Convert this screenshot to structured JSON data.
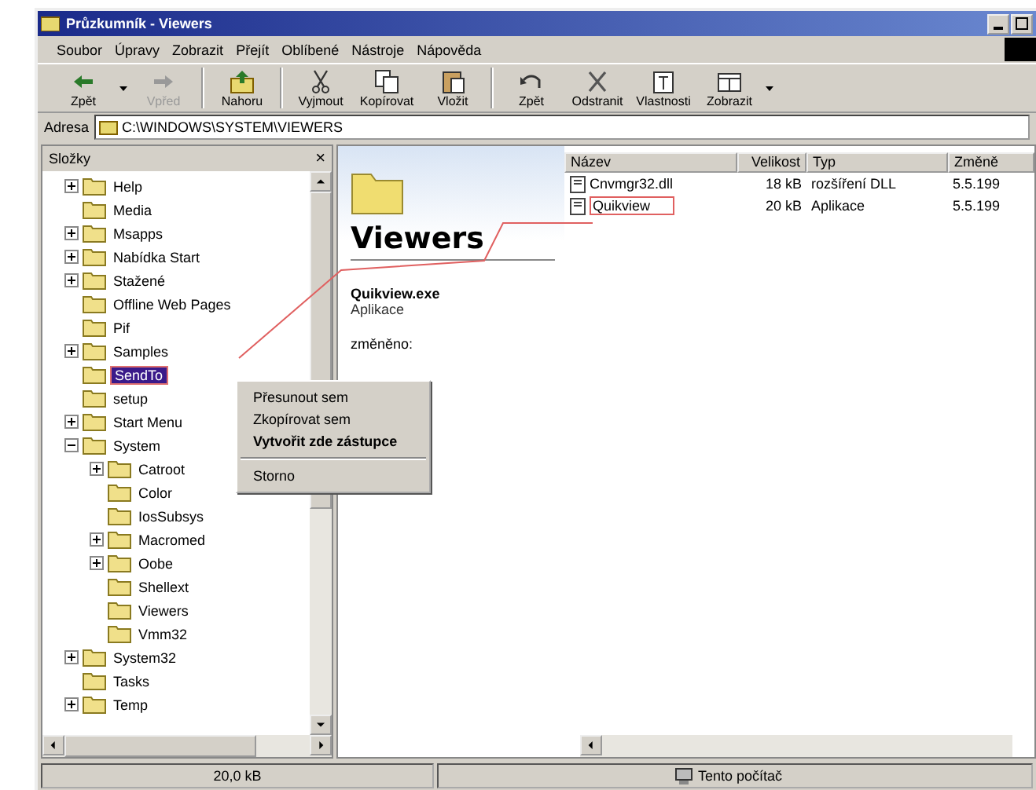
{
  "window": {
    "title": "Průzkumník - Viewers"
  },
  "menu": [
    "Soubor",
    "Úpravy",
    "Zobrazit",
    "Přejít",
    "Oblíbené",
    "Nástroje",
    "Nápověda"
  ],
  "toolbar": [
    {
      "kind": "back",
      "label": "Zpět",
      "disabled": false
    },
    {
      "kind": "forward",
      "label": "Vpřed",
      "disabled": true
    },
    {
      "kind": "up",
      "label": "Nahoru",
      "disabled": false
    },
    {
      "kind": "cut",
      "label": "Vyjmout",
      "disabled": false
    },
    {
      "kind": "copy",
      "label": "Kopírovat",
      "disabled": false
    },
    {
      "kind": "paste",
      "label": "Vložit",
      "disabled": false
    },
    {
      "kind": "undo",
      "label": "Zpět",
      "disabled": false
    },
    {
      "kind": "delete",
      "label": "Odstranit",
      "disabled": false
    },
    {
      "kind": "properties",
      "label": "Vlastnosti",
      "disabled": false
    },
    {
      "kind": "views",
      "label": "Zobrazit",
      "disabled": false
    }
  ],
  "address": {
    "label": "Adresa",
    "value": "C:\\WINDOWS\\SYSTEM\\VIEWERS"
  },
  "folders_panel": {
    "title": "Složky",
    "close": "×",
    "tree": [
      {
        "label": "Help",
        "expanded": false,
        "selected": false
      },
      {
        "label": "Media",
        "selected": false
      },
      {
        "label": "Msapps",
        "expanded": false,
        "selected": false
      },
      {
        "label": "Nabídka Start",
        "expanded": false,
        "selected": false
      },
      {
        "label": "Stažené",
        "expanded": false,
        "selected": false
      },
      {
        "label": "Offline Web Pages",
        "selected": false
      },
      {
        "label": "Pif",
        "selected": false
      },
      {
        "label": "Samples",
        "expanded": false,
        "selected": false
      },
      {
        "label": "SendTo",
        "selected": true
      },
      {
        "label": "setup",
        "selected": false
      },
      {
        "label": "Start Menu",
        "expanded": false,
        "selected": false
      },
      {
        "label": "System",
        "expanded": true,
        "selected": false,
        "children": [
          {
            "label": "Catroot",
            "expanded": false,
            "selected": false
          },
          {
            "label": "Color",
            "selected": false
          },
          {
            "label": "IosSubsys",
            "selected": false
          },
          {
            "label": "Macromed",
            "expanded": false,
            "selected": false
          },
          {
            "label": "Oobe",
            "expanded": false,
            "selected": false
          },
          {
            "label": "Shellext",
            "selected": false
          },
          {
            "label": "Viewers",
            "selected": false
          },
          {
            "label": "Vmm32",
            "selected": false
          }
        ]
      },
      {
        "label": "System32",
        "expanded": false,
        "selected": false
      },
      {
        "label": "Tasks",
        "selected": false
      },
      {
        "label": "Temp",
        "expanded": false,
        "selected": false
      }
    ]
  },
  "webview": {
    "title": "Viewers",
    "file_name": "Quikview.exe",
    "file_type": "Aplikace",
    "modified_label": "změněno:"
  },
  "file_list": {
    "columns": [
      "Název",
      "Velikost",
      "Typ",
      "Změně"
    ],
    "rows": [
      {
        "cells": [
          "Cnvmgr32.dll",
          "18 kB",
          "rozšíření DLL",
          "5.5.199"
        ],
        "selected": false
      },
      {
        "cells": [
          "Quikview",
          "20 kB",
          "Aplikace",
          "5.5.199"
        ],
        "selected": false
      }
    ]
  },
  "context_menu": [
    {
      "label": "Přesunout sem",
      "default": false
    },
    {
      "label": "Zkopírovat sem",
      "default": false
    },
    {
      "label": "Vytvořit zde zástupce",
      "default": true
    },
    {
      "label": "Storno",
      "default": false
    }
  ],
  "status_bar": {
    "size": "20,0 kB",
    "location": "Tento počítač"
  }
}
